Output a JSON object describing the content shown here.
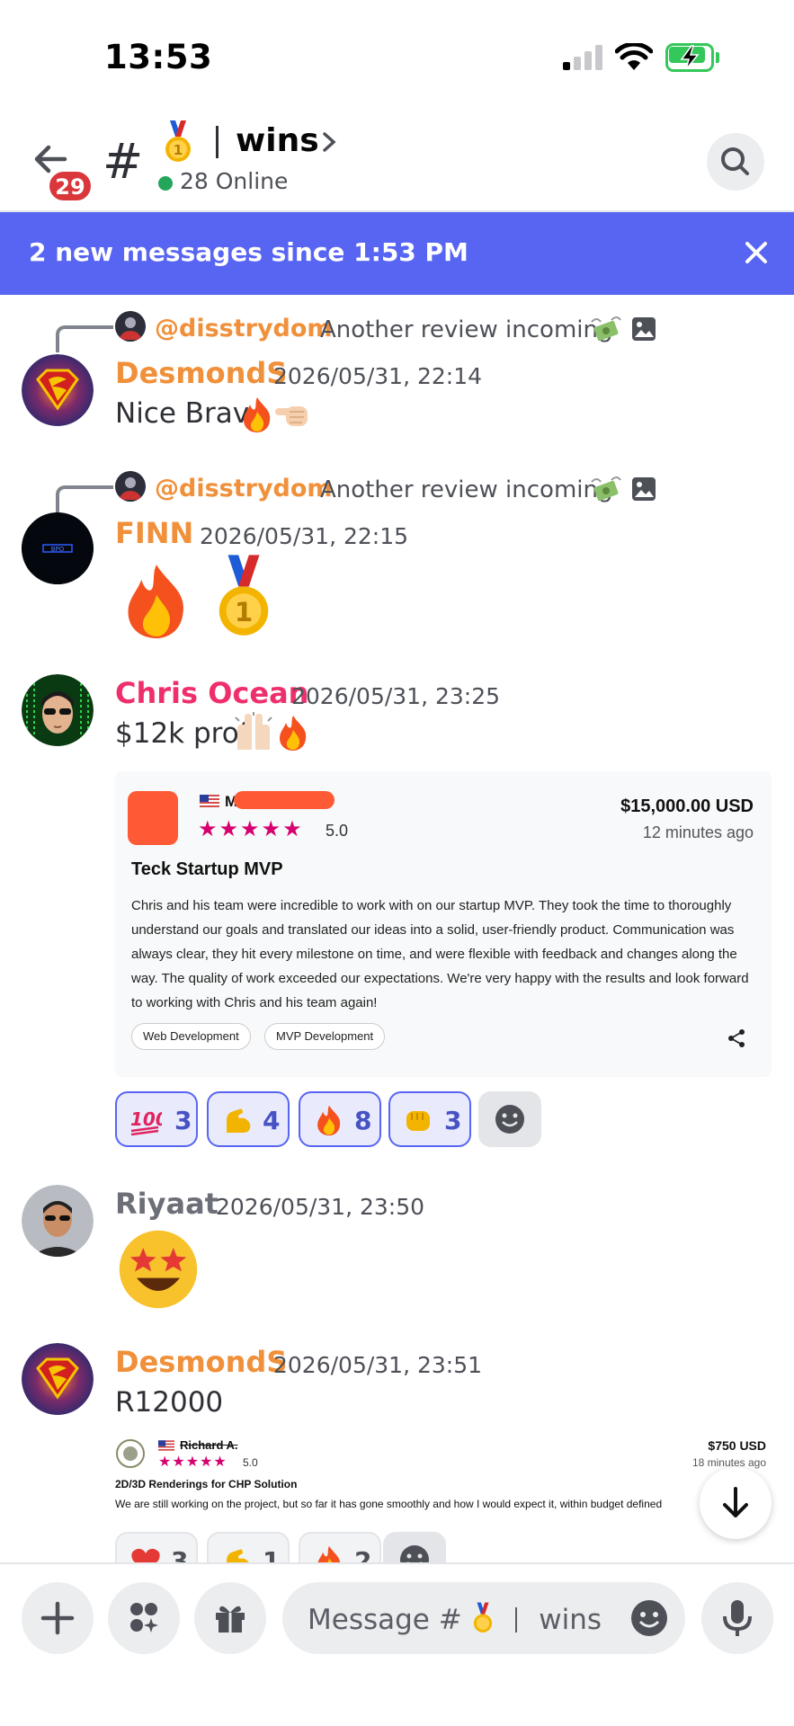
{
  "status_bar": {
    "time": "13:53"
  },
  "header": {
    "back_badge": "29",
    "hash": "#",
    "channel_name": "wins",
    "online": "28 Online"
  },
  "banner": {
    "text": "2 new messages since 1:53 PM"
  },
  "messages": [
    {
      "reply_author": "@disstrydom",
      "reply_text": "Another review incoming",
      "author": "DesmondS",
      "author_color": "#f0903a",
      "timestamp": "2026/05/31, 22:14",
      "content": "Nice Brav"
    },
    {
      "reply_author": "@disstrydom",
      "reply_text": "Another review incoming",
      "author": "FINN",
      "author_color": "#f0903a",
      "timestamp": "2026/05/31, 22:15"
    },
    {
      "author": "Chris Ocean",
      "author_color": "#ef2f6b",
      "timestamp": "2026/05/31, 23:25",
      "content": "$12k prof",
      "embed": {
        "reviewer_initial": "M",
        "rating": "5.0",
        "price": "$15,000.00 USD",
        "ago": "12 minutes ago",
        "title": "Teck Startup MVP",
        "body": "Chris and his team were incredible to work with on our startup MVP. They took the time to thoroughly understand our goals and translated our ideas into a solid, user-friendly product. Communication was always clear, they hit every milestone on time, and were flexible with feedback and changes along the way. The quality of work exceeded our expectations. We're very happy with the results and look forward to working with Chris and his team again!",
        "tags": [
          "Web Development",
          "MVP Development"
        ]
      },
      "reactions": [
        {
          "emoji": "hundred-points",
          "count": "3"
        },
        {
          "emoji": "flexed-biceps",
          "count": "4"
        },
        {
          "emoji": "fire",
          "count": "8"
        },
        {
          "emoji": "oncoming-fist",
          "count": "3"
        }
      ]
    },
    {
      "author": "Riyaat",
      "author_color": "#6d6f78",
      "timestamp": "2026/05/31, 23:50"
    },
    {
      "author": "DesmondS",
      "author_color": "#f0903a",
      "timestamp": "2026/05/31, 23:51",
      "content": "R12000",
      "embed": {
        "reviewer": "Richard A.",
        "rating": "5.0",
        "price": "$750 USD",
        "ago": "18 minutes ago",
        "title": "2D/3D Renderings for CHP Solution",
        "body": "We are still working on the project, but so far it has gone smoothly and how I would expect it, within budget defined"
      },
      "reactions": [
        {
          "emoji": "red-heart",
          "count": "3"
        },
        {
          "emoji": "flexed-biceps",
          "count": "1"
        },
        {
          "emoji": "fire",
          "count": "2"
        }
      ]
    }
  ],
  "composer": {
    "placeholder_prefix": "Message #",
    "placeholder_channel": "wins"
  },
  "colors": {
    "accent": "#5865f2",
    "badge": "#da373c",
    "online": "#23a55a",
    "review_stars": "#d6006f"
  }
}
